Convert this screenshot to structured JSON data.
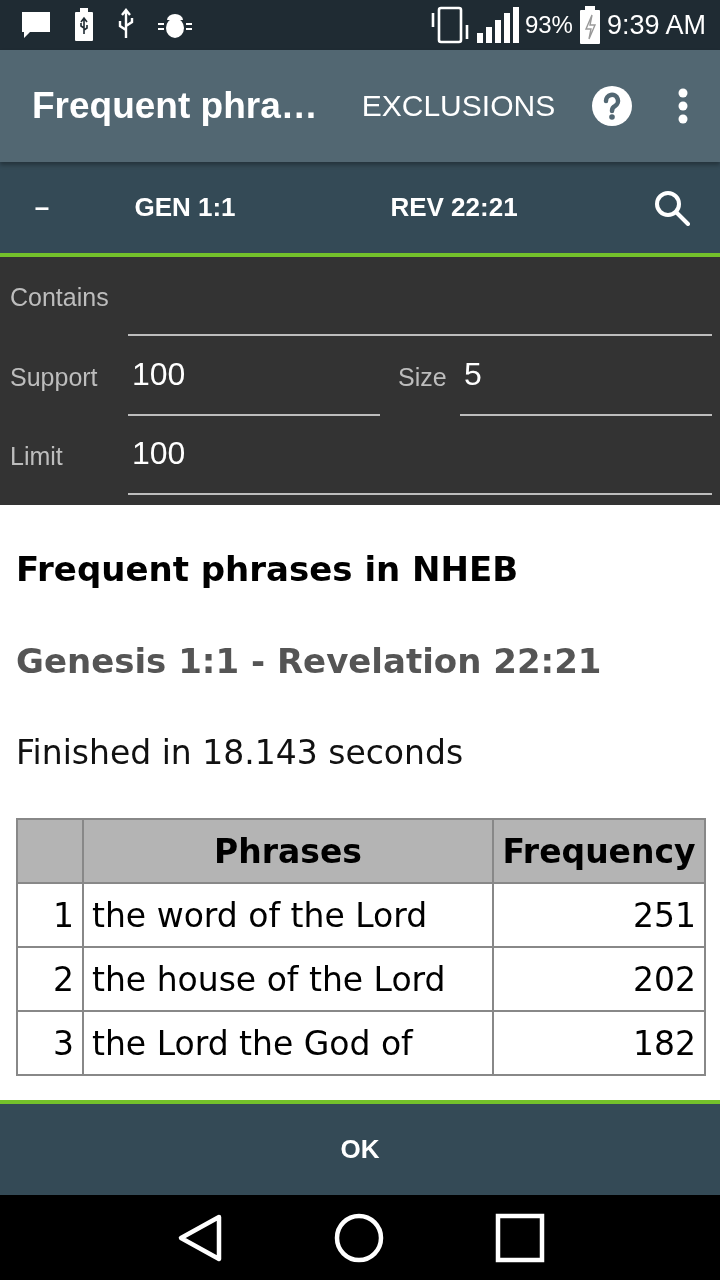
{
  "status_bar": {
    "battery": "93%",
    "time": "9:39 AM"
  },
  "app_bar": {
    "title": "Frequent phra…",
    "action": "EXCLUSIONS"
  },
  "range_bar": {
    "left": "–",
    "from": "GEN 1:1",
    "to": "REV 22:21"
  },
  "form": {
    "rows": [
      [
        {
          "label": "Contains"
        }
      ],
      [
        {
          "label": "Support",
          "value": "100"
        },
        {
          "label": "Size",
          "value": "5"
        }
      ],
      [
        {
          "label": "Limit",
          "value": "100"
        }
      ]
    ]
  },
  "report": {
    "title": "Frequent phrases in NHEB",
    "range": "Genesis 1:1 - Revelation 22:21",
    "timing": "Finished in 18.143 seconds",
    "table": {
      "columns": [
        "Phrases",
        "Frequency"
      ],
      "rows": [
        {
          "index": "1",
          "phrase": "the word of the Lord",
          "frequency": "251"
        },
        {
          "index": "2",
          "phrase": "the house of the Lord",
          "frequency": "202"
        },
        {
          "index": "3",
          "phrase": "the Lord the God of",
          "frequency": "182"
        }
      ]
    }
  },
  "ok_button": "OK"
}
